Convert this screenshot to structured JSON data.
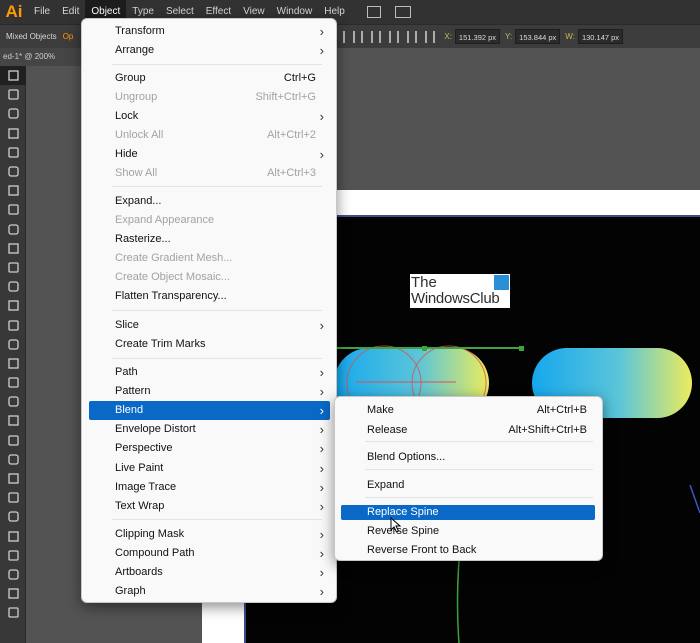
{
  "app": {
    "logo": "Ai"
  },
  "menubar": {
    "items": [
      "File",
      "Edit",
      "Object",
      "Type",
      "Select",
      "Effect",
      "View",
      "Window",
      "Help"
    ],
    "active": "Object"
  },
  "controlbar": {
    "selection_label": "Mixed Objects",
    "opacity_fragment": "Op",
    "x_label": "X:",
    "x_value": "151.392 px",
    "y_label": "Y:",
    "y_value": "153.844 px",
    "w_label": "W:",
    "w_value": "130.147 px"
  },
  "document": {
    "tab_fragment": "ed-1* @ 200%"
  },
  "colors": {
    "highlight": "#0a68c7",
    "menu_bg": "#f9f9f9",
    "app_dark": "#323232",
    "canvas_dark": "#030303",
    "gradient_start": "#15a8ee",
    "gradient_end": "#ecec5c"
  },
  "object_menu": {
    "items": [
      {
        "label": "Transform",
        "submenu": true
      },
      {
        "label": "Arrange",
        "submenu": true
      },
      {
        "label": "Group",
        "shortcut": "Ctrl+G"
      },
      {
        "label": "Ungroup",
        "shortcut": "Shift+Ctrl+G",
        "disabled": true
      },
      {
        "label": "Lock",
        "submenu": true
      },
      {
        "label": "Unlock All",
        "shortcut": "Alt+Ctrl+2",
        "disabled": true
      },
      {
        "label": "Hide",
        "submenu": true
      },
      {
        "label": "Show All",
        "shortcut": "Alt+Ctrl+3",
        "disabled": true
      },
      {
        "label": "Expand..."
      },
      {
        "label": "Expand Appearance",
        "disabled": true
      },
      {
        "label": "Rasterize..."
      },
      {
        "label": "Create Gradient Mesh...",
        "disabled": true
      },
      {
        "label": "Create Object Mosaic...",
        "disabled": true
      },
      {
        "label": "Flatten Transparency..."
      },
      {
        "label": "Slice",
        "submenu": true
      },
      {
        "label": "Create Trim Marks"
      },
      {
        "label": "Path",
        "submenu": true
      },
      {
        "label": "Pattern",
        "submenu": true
      },
      {
        "label": "Blend",
        "submenu": true,
        "highlighted": true
      },
      {
        "label": "Envelope Distort",
        "submenu": true
      },
      {
        "label": "Perspective",
        "submenu": true
      },
      {
        "label": "Live Paint",
        "submenu": true
      },
      {
        "label": "Image Trace",
        "submenu": true
      },
      {
        "label": "Text Wrap",
        "submenu": true
      },
      {
        "label": "Clipping Mask",
        "submenu": true
      },
      {
        "label": "Compound Path",
        "submenu": true
      },
      {
        "label": "Artboards",
        "submenu": true
      },
      {
        "label": "Graph",
        "submenu": true
      }
    ]
  },
  "blend_submenu": {
    "items": [
      {
        "label": "Make",
        "shortcut": "Alt+Ctrl+B"
      },
      {
        "label": "Release",
        "shortcut": "Alt+Shift+Ctrl+B"
      },
      {
        "label": "Blend Options..."
      },
      {
        "label": "Expand"
      },
      {
        "label": "Replace Spine",
        "highlighted": true
      },
      {
        "label": "Reverse Spine"
      },
      {
        "label": "Reverse Front to Back"
      }
    ]
  },
  "canvas": {
    "watermark_line1": "The",
    "watermark_line2": "WindowsClub"
  },
  "tools": [
    "selection",
    "direct-selection",
    "magic-wand",
    "lasso",
    "pen",
    "type",
    "line",
    "ellipse",
    "paintbrush",
    "pencil",
    "shaper",
    "eraser",
    "rotate",
    "scale",
    "warp",
    "free-transform",
    "shape-builder",
    "perspective",
    "mesh",
    "gradient",
    "eyedropper",
    "blend",
    "symbol-sprayer",
    "graph",
    "artboard",
    "slice",
    "hand",
    "zoom",
    "fill-stroke"
  ]
}
